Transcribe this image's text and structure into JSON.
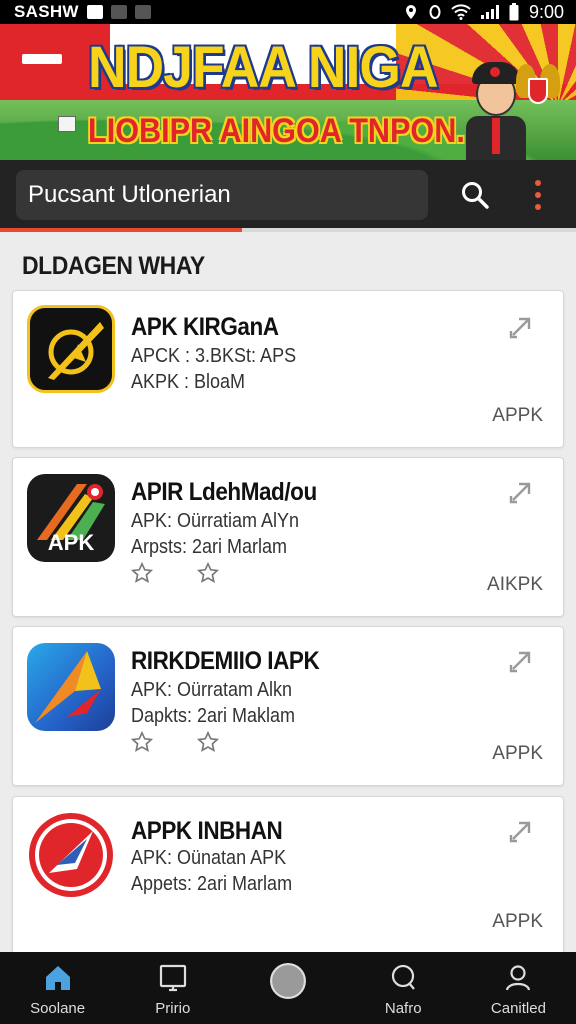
{
  "status_bar": {
    "left_text": "SASHW",
    "time": "9:00"
  },
  "banner": {
    "title": "NDJFAA NIGA",
    "subtitle": "LIOBIPR AINGOA TNPON."
  },
  "search": {
    "value": "Pucsant Utlonerian"
  },
  "progress_percent": 42,
  "section_title": "DLDAGEN WHAY",
  "cards": [
    {
      "name": "APK KIRGanA",
      "line1": "APCK : 3.BKSt: APS",
      "line2": "AKPK : BloaM",
      "tag": "APPK"
    },
    {
      "name": "APIR LdehMad/ou",
      "line1": "APK: Oürratiam AlYn",
      "line2": "Arpsts: 2ari Marlam",
      "tag": "AIKPK",
      "icon_text": "APK"
    },
    {
      "name": "RIRKDEMIIO IAPK",
      "line1": "APK: Oürratam Alkn",
      "line2": "Dapkts: 2ari Maklam",
      "tag": "APPK"
    },
    {
      "name": "APPK INBHAN",
      "line1": "APK: Oünatan APK",
      "line2": "Appets: 2ari Marlam",
      "tag": "APPK"
    }
  ],
  "bottom_nav": [
    {
      "label": "Soolane"
    },
    {
      "label": "Pririo"
    },
    {
      "label": ""
    },
    {
      "label": "Nafro"
    },
    {
      "label": "Canitled"
    }
  ],
  "colors": {
    "accent": "#e8492c",
    "nav_active": "#4aa3df",
    "banner_red": "#e1262b",
    "banner_yellow": "#f7d31c"
  }
}
